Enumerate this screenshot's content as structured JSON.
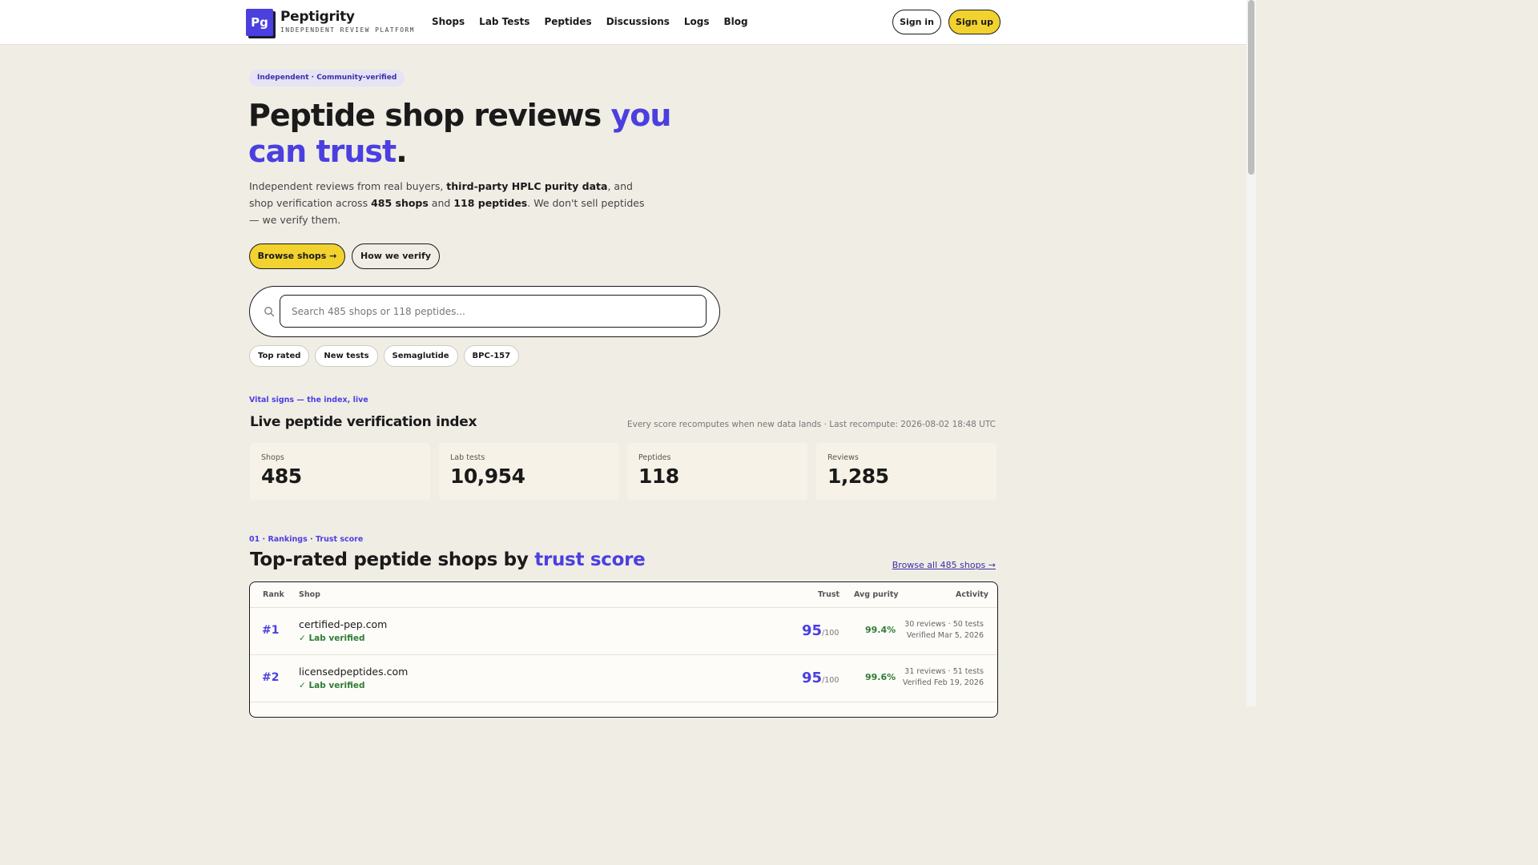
{
  "header": {
    "logo_mark": "Pg",
    "brand": "Peptigrity",
    "tagline": "INDEPENDENT REVIEW PLATFORM",
    "nav": [
      "Shops",
      "Lab Tests",
      "Peptides",
      "Discussions",
      "Logs",
      "Blog"
    ],
    "sign_in": "Sign in",
    "sign_up": "Sign up"
  },
  "hero": {
    "pill": "Independent · Community-verified",
    "title_main": "Peptide shop reviews ",
    "title_accent": "you can trust",
    "title_end": ".",
    "desc_1": "Independent reviews from real buyers, ",
    "desc_b1": "third-party HPLC purity data",
    "desc_2": ", and shop verification across ",
    "desc_b2": "485 shops",
    "desc_3": " and ",
    "desc_b3": "118 peptides",
    "desc_4": ". We don't sell peptides — we verify them.",
    "browse_btn": "Browse shops →",
    "how_btn": "How we verify"
  },
  "search": {
    "placeholder": "Search 485 shops or 118 peptides..."
  },
  "chips": [
    "Top rated",
    "New tests",
    "Semaglutide",
    "BPC-157"
  ],
  "vitals": {
    "eyebrow": "Vital signs — the index, live",
    "title": "Live peptide verification index",
    "recompute": "Every score recomputes when new data lands · Last recompute: 2026-08-02 18:48 UTC",
    "stats": [
      {
        "label": "Shops",
        "value": "485"
      },
      {
        "label": "Lab tests",
        "value": "10,954"
      },
      {
        "label": "Peptides",
        "value": "118"
      },
      {
        "label": "Reviews",
        "value": "1,285"
      }
    ]
  },
  "rankings": {
    "eyebrow": "01 · Rankings · Trust score",
    "title_main": "Top-rated peptide shops by ",
    "title_accent": "trust score",
    "browse_link": "Browse all 485 shops →",
    "columns": {
      "rank": "Rank",
      "shop": "Shop",
      "trust": "Trust",
      "purity": "Avg purity",
      "activity": "Activity"
    },
    "rows": [
      {
        "rank": "#1",
        "shop": "certified-pep.com",
        "badge": "✓ Lab verified",
        "trust": "95",
        "trust_den": "/100",
        "purity": "99.4%",
        "activity": "30 reviews · 50 tests",
        "verified": "Verified Mar 5, 2026"
      },
      {
        "rank": "#2",
        "shop": "licensedpeptides.com",
        "badge": "✓ Lab verified",
        "trust": "95",
        "trust_den": "/100",
        "purity": "99.6%",
        "activity": "31 reviews · 51 tests",
        "verified": "Verified Feb 19, 2026"
      }
    ]
  },
  "colors": {
    "accent": "#4b3fe0",
    "cta": "#f2d22e",
    "success": "#2e7d32",
    "background": "#f0ede5"
  }
}
